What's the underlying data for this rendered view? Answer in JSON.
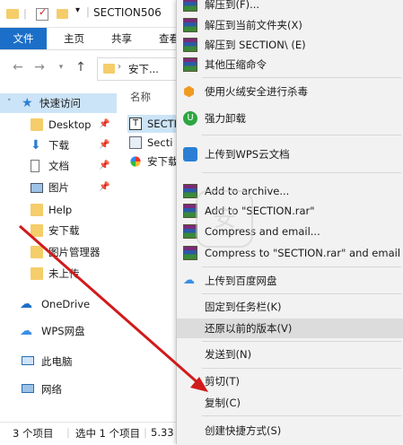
{
  "window": {
    "title": "SECTION506"
  },
  "ribbon": {
    "tabs": [
      "文件",
      "主页",
      "共享",
      "查看"
    ]
  },
  "address": {
    "path": "安下..."
  },
  "sidebar": {
    "items": [
      {
        "label": "快速访问",
        "icon": "star-icon"
      },
      {
        "label": "Desktop",
        "icon": "folder-icon"
      },
      {
        "label": "下载",
        "icon": "download-icon"
      },
      {
        "label": "文档",
        "icon": "document-icon"
      },
      {
        "label": "图片",
        "icon": "picture-icon"
      },
      {
        "label": "Help",
        "icon": "folder-icon"
      },
      {
        "label": "安下载",
        "icon": "folder-icon"
      },
      {
        "label": "图片管理器",
        "icon": "folder-icon"
      },
      {
        "label": "未上传",
        "icon": "folder-icon"
      },
      {
        "label": "OneDrive",
        "icon": "cloud-icon"
      },
      {
        "label": "WPS网盘",
        "icon": "cloud-icon"
      },
      {
        "label": "此电脑",
        "icon": "computer-icon"
      },
      {
        "label": "网络",
        "icon": "network-icon"
      }
    ]
  },
  "files": {
    "header": "名称",
    "rows": [
      "SECTI",
      "Secti",
      "安下载"
    ]
  },
  "status": {
    "count": "3 个项目",
    "selected": "选中 1 个项目",
    "size": "5.33"
  },
  "menu": {
    "items": [
      {
        "label": "解压到(F)..."
      },
      {
        "label": "解压到当前文件夹(X)"
      },
      {
        "label": "解压到 SECTION\\ (E)"
      },
      {
        "label": "其他压缩命令"
      },
      {
        "label": "使用火绒安全进行杀毒"
      },
      {
        "label": "强力卸载"
      },
      {
        "label": "上传到WPS云文档"
      },
      {
        "label": "Add to archive..."
      },
      {
        "label": "Add to \"SECTION.rar\""
      },
      {
        "label": "Compress and email..."
      },
      {
        "label": "Compress to \"SECTION.rar\" and email"
      },
      {
        "label": "上传到百度网盘"
      },
      {
        "label": "固定到任务栏(K)"
      },
      {
        "label": "还原以前的版本(V)"
      },
      {
        "label": "发送到(N)"
      },
      {
        "label": "剪切(T)"
      },
      {
        "label": "复制(C)"
      },
      {
        "label": "创建快捷方式(S)"
      }
    ]
  },
  "watermark": {
    "text": "安"
  },
  "colors": {
    "accent": "#1b6fc8",
    "arrow": "#d11a1a",
    "menu_bg": "#f2f2f2"
  }
}
